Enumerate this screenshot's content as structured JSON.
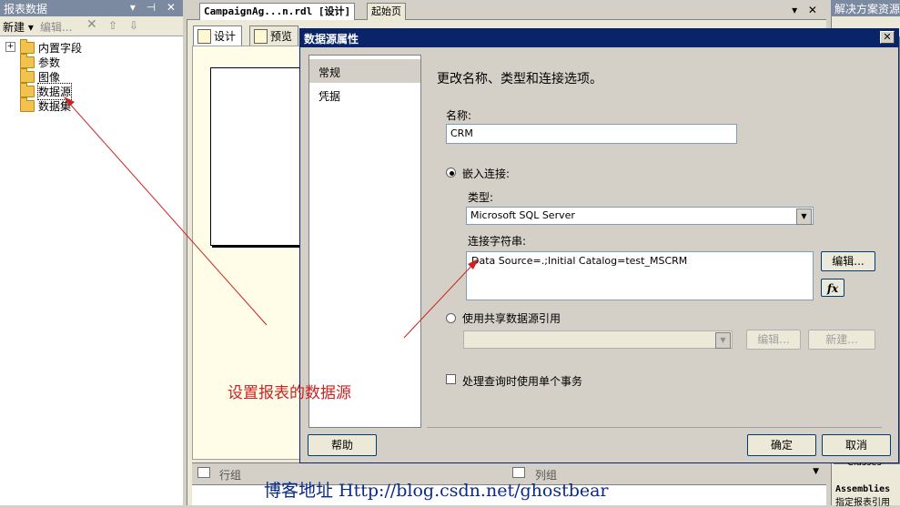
{
  "left_panel": {
    "title": "报表数据",
    "title_controls": "▾ ⊣ ✕",
    "toolbar": {
      "new_label": "新建 ▾",
      "edit_label": "编辑...",
      "delete_icon": "✕",
      "up_icon": "⇧",
      "down_icon": "⇩"
    },
    "tree": [
      {
        "label": "内置字段",
        "expander": "+"
      },
      {
        "label": "参数"
      },
      {
        "label": "图像"
      },
      {
        "label": "数据源"
      },
      {
        "label": "数据集"
      }
    ]
  },
  "document": {
    "tabs": [
      "CampaignAg...n.rdl [设计]",
      "起始页"
    ],
    "tab_controls": "▾ ✕",
    "inner_tabs": [
      "设计",
      "预览"
    ],
    "group_panes": {
      "row_groups": "行组",
      "column_groups": "列组"
    }
  },
  "right_panel": {
    "title": "解决方案资源",
    "list_item": "Classes",
    "bottom_title": "Assemblies",
    "bottom_sub": "指定报表引用"
  },
  "dialog": {
    "title": "数据源属性",
    "close": "✕",
    "nav": [
      "常规",
      "凭据"
    ],
    "heading": "更改名称、类型和连接选项。",
    "name_label": "名称:",
    "name_value": "CRM",
    "embedded_label": "嵌入连接:",
    "type_label": "类型:",
    "type_value": "Microsoft SQL Server",
    "conn_label": "连接字符串:",
    "conn_value": "Data Source=.;Initial Catalog=test_MSCRM",
    "edit_button": "编辑...",
    "fx_button": "fx",
    "shared_label": "使用共享数据源引用",
    "shared_edit": "编辑...",
    "shared_new": "新建...",
    "transaction_label": "处理查询时使用单个事务",
    "help": "帮助",
    "ok": "确定",
    "cancel": "取消"
  },
  "annotations": {
    "caption": "设置报表的数据源",
    "blog": "博客地址 Http://blog.csdn.net/ghostbear"
  }
}
